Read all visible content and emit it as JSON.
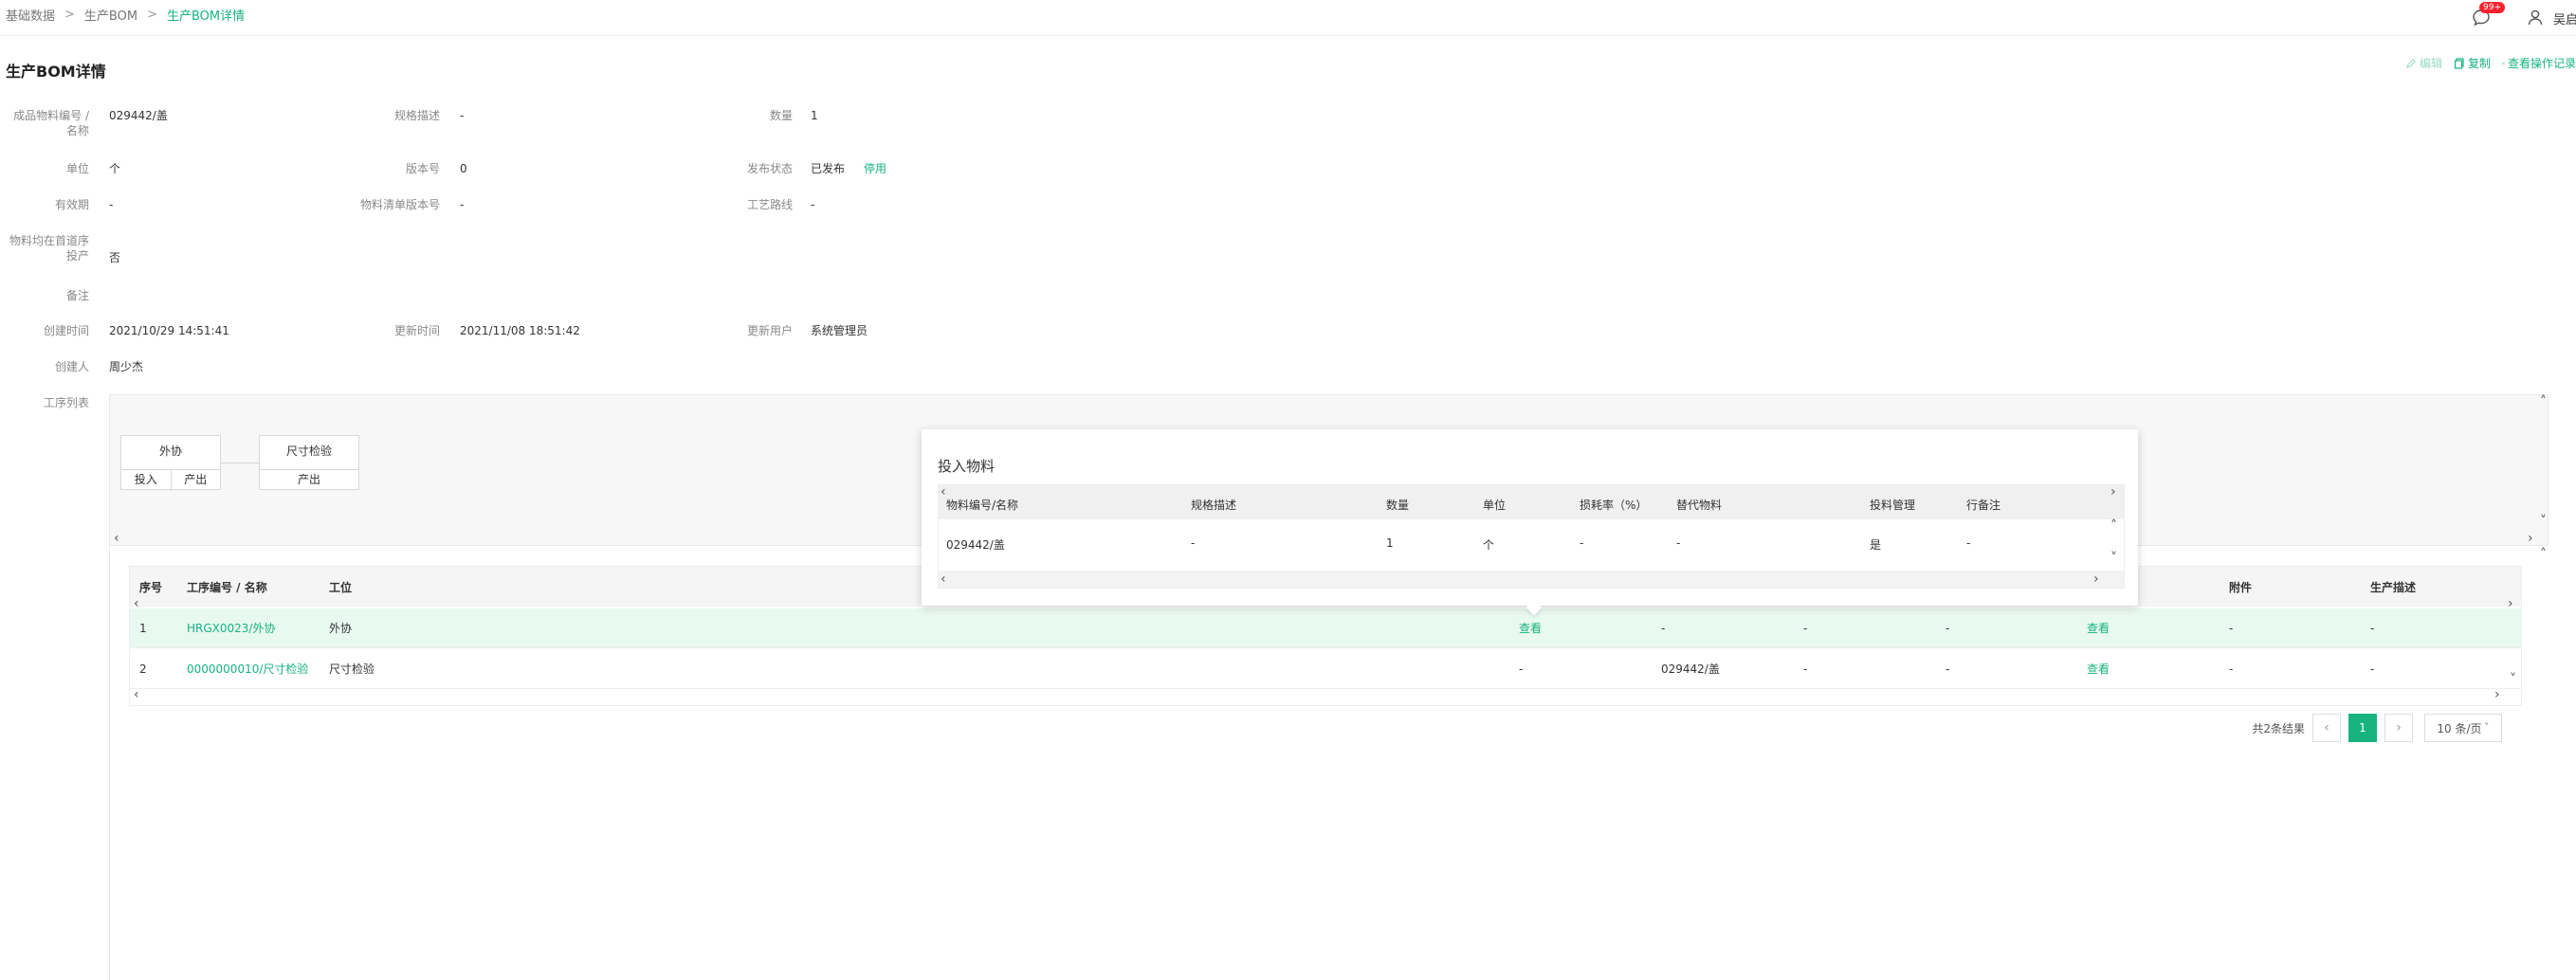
{
  "breadcrumb": {
    "items": [
      "基础数据",
      "生产BOM",
      "生产BOM详情"
    ]
  },
  "header": {
    "notification_badge": "99+",
    "user_name": "吴启"
  },
  "page": {
    "title": "生产BOM详情"
  },
  "actions": {
    "edit": "编辑",
    "copy": "复制",
    "log": "查看操作记录"
  },
  "form": {
    "product_label": "成品物料编号 / 名称",
    "product_value": "029442/盖",
    "spec_label": "规格描述",
    "spec_value": "-",
    "qty_label": "数量",
    "qty_value": "1",
    "unit_label": "单位",
    "unit_value": "个",
    "version_label": "版本号",
    "version_value": "0",
    "publish_label": "发布状态",
    "publish_value": "已发布",
    "publish_action": "停用",
    "validity_label": "有效期",
    "validity_value": "-",
    "bom_version_label": "物料清单版本号",
    "bom_version_value": "-",
    "route_label": "工艺路线",
    "route_value": "-",
    "first_process_label": "物料均在首道序投产",
    "first_process_value": "否",
    "remark_label": "备注",
    "created_time_label": "创建时间",
    "created_time_value": "2021/10/29 14:51:41",
    "updated_time_label": "更新时间",
    "updated_time_value": "2021/11/08 18:51:42",
    "updated_user_label": "更新用户",
    "updated_user_value": "系统管理员",
    "creator_label": "创建人",
    "creator_value": "周少杰",
    "process_list_label": "工序列表"
  },
  "route": {
    "nodes": [
      {
        "title": "外协",
        "io": [
          "投入",
          "产出"
        ]
      },
      {
        "title": "尺寸检验",
        "io": [
          "产出"
        ]
      }
    ]
  },
  "process_table": {
    "headers": {
      "seq": "序号",
      "code": "工序编号 / 名称",
      "station": "工位",
      "attachment": "附件",
      "desc": "生产描述"
    },
    "rows": [
      {
        "seq": "1",
        "code": "HRGX0023/外协",
        "station": "外协",
        "input": "查看",
        "output": "-",
        "c3": "-",
        "c4": "-",
        "view": "查看",
        "attachment": "-",
        "desc": "-"
      },
      {
        "seq": "2",
        "code": "0000000010/尺寸检验",
        "station": "尺寸检验",
        "input": "-",
        "output": "029442/盖",
        "c3": "-",
        "c4": "-",
        "view": "查看",
        "attachment": "-",
        "desc": "-"
      }
    ]
  },
  "pagination": {
    "total": "共2条结果",
    "current": "1",
    "page_size": "10 条/页"
  },
  "popover": {
    "title": "投入物料",
    "headers": [
      "物料编号/名称",
      "规格描述",
      "数量",
      "单位",
      "损耗率（%）",
      "替代物料",
      "投料管理",
      "行备注"
    ],
    "row": [
      "029442/盖",
      "-",
      "1",
      "个",
      "-",
      "-",
      "是",
      "-"
    ]
  },
  "colors": {
    "accent": "#18b37e",
    "highlight_row": "#e8f9f1",
    "badge": "#f5222d"
  }
}
